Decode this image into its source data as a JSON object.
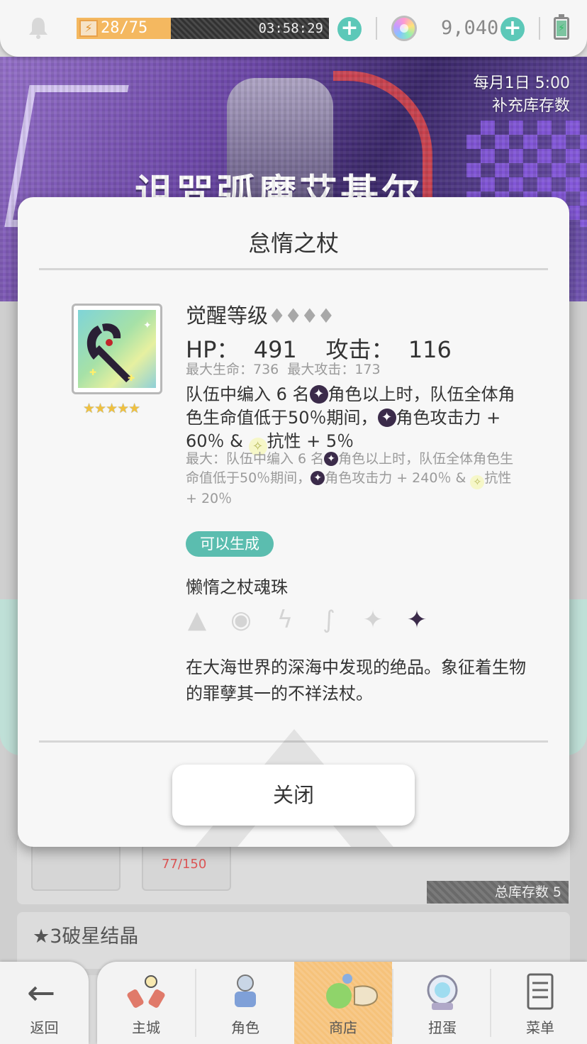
{
  "topbar": {
    "stamina_text": "28/75",
    "stamina_fraction": 0.373,
    "stamina_timer": "03:58:29",
    "gem_count": "9,040",
    "icons": [
      "bell-icon",
      "bolt-icon",
      "plus-icon",
      "rainbow-gem-icon",
      "battery-icon"
    ]
  },
  "banner": {
    "title": "诅咒弧魔艾基尔",
    "note_line1": "每月1日 5:00",
    "note_line2": "补充库存数"
  },
  "modal": {
    "title": "怠惰之杖",
    "awaken_label": "觉醒等级",
    "awaken_diamonds": "♦♦♦♦",
    "stats": "HP：  491    攻击：  116",
    "stats_max": "最大生命：736  最大攻击：173",
    "skill_p1": "队伍中编入 6 名",
    "skill_p2": "角色以上时，队伍全体角色生命值低于50％期间，",
    "skill_p3": "角色攻击力 + 60％ & ",
    "skill_p4": "抗性 + 5％",
    "skill_max_p1": "最大：队伍中编入 6 名",
    "skill_max_p2": "角色以上时，队伍全体角色生命值低于50％期间，",
    "skill_max_p3": "角色攻击力 + 240％ & ",
    "skill_max_p4": "抗性 + 20％",
    "tag": "可以生成",
    "soul_name": "懒惰之杖魂珠",
    "elements": [
      "fire-element-icon",
      "water-element-icon",
      "thunder-element-icon",
      "wind-element-icon",
      "light-element-icon",
      "dark-element-icon"
    ],
    "active_element": "dark-element-icon",
    "rarity_stars": "★★★★★",
    "description": "在大海世界的深海中发现的绝品。象征着生物的罪孽其一的不祥法杖。",
    "close_label": "关闭"
  },
  "background": {
    "count": "77/150",
    "stock": "总库存数 5",
    "section_title": "★3破星结晶"
  },
  "nav": {
    "back": "返回",
    "items": [
      "主城",
      "角色",
      "商店",
      "扭蛋",
      "菜单"
    ],
    "active": "商店"
  },
  "colors": {
    "accent_teal": "#5bbdaf",
    "stamina_orange": "#f4b860",
    "nav_active": "#f6c27a",
    "dark_element": "#3b2b4a"
  }
}
